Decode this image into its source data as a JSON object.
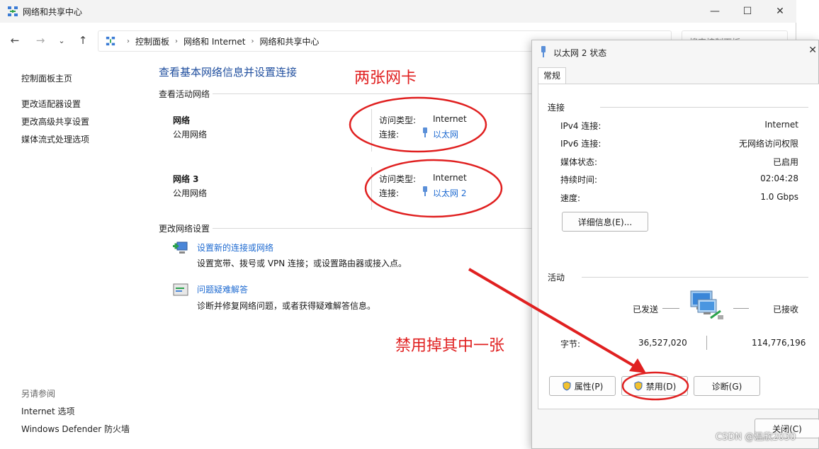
{
  "main": {
    "title": "网络和共享中心",
    "breadcrumb": [
      "控制面板",
      "网络和 Internet",
      "网络和共享中心"
    ],
    "search_placeholder": "搜索控制面板",
    "sidebar": {
      "home": "控制面板主页",
      "links": [
        "更改适配器设置",
        "更改高级共享设置",
        "媒体流式处理选项"
      ],
      "see_also_label": "另请参阅",
      "see_also": [
        "Internet 选项",
        "Windows Defender 防火墙"
      ]
    },
    "heading": "查看基本网络信息并设置连接",
    "active_label": "查看活动网络",
    "networks": [
      {
        "name": "网络",
        "type": "公用网络",
        "access_label": "访问类型:",
        "access": "Internet",
        "conn_label": "连接:",
        "conn": "以太网"
      },
      {
        "name": "网络 3",
        "type": "公用网络",
        "access_label": "访问类型:",
        "access": "Internet",
        "conn_label": "连接:",
        "conn": "以太网 2"
      }
    ],
    "change_label": "更改网络设置",
    "tasks": [
      {
        "link": "设置新的连接或网络",
        "desc": "设置宽带、拨号或 VPN 连接；或设置路由器或接入点。"
      },
      {
        "link": "问题疑难解答",
        "desc": "诊断并修复网络问题，或者获得疑难解答信息。"
      }
    ]
  },
  "dialog": {
    "title": "以太网 2 状态",
    "tab": "常规",
    "connection_label": "连接",
    "rows": [
      {
        "label": "IPv4 连接:",
        "value": "Internet"
      },
      {
        "label": "IPv6 连接:",
        "value": "无网络访问权限"
      },
      {
        "label": "媒体状态:",
        "value": "已启用"
      },
      {
        "label": "持续时间:",
        "value": "02:04:28"
      },
      {
        "label": "速度:",
        "value": "1.0 Gbps"
      }
    ],
    "details_button": "详细信息(E)...",
    "activity_label": "活动",
    "sent_label": "已发送",
    "received_label": "已接收",
    "bytes_label": "字节:",
    "bytes_sent": "36,527,020",
    "bytes_received": "114,776,196",
    "properties_button": "属性(P)",
    "disable_button": "禁用(D)",
    "diagnose_button": "诊断(G)",
    "close_button": "关闭(C)"
  },
  "annotations": {
    "two_nics": "两张网卡",
    "disable_one": "禁用掉其中一张",
    "color": "#e02020"
  },
  "watermark": "CSDN @温欣2030"
}
